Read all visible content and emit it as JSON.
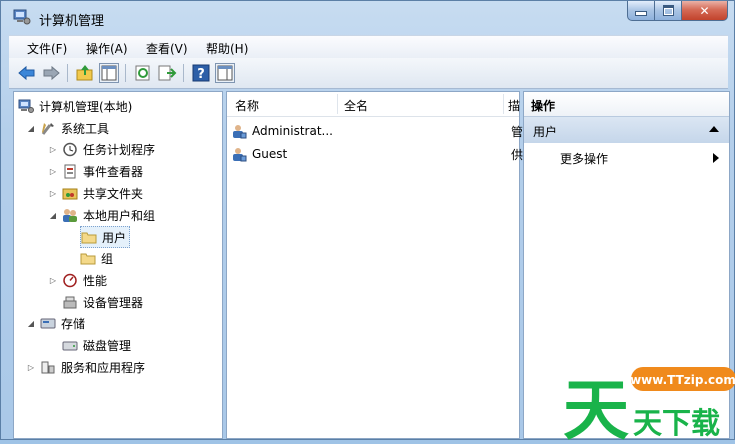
{
  "window": {
    "title": "计算机管理",
    "min_icon": "minimize-icon",
    "max_icon": "maximize-icon",
    "close_icon": "close-icon"
  },
  "menu": [
    "文件(F)",
    "操作(A)",
    "查看(V)",
    "帮助(H)"
  ],
  "toolbar": [
    "back-icon",
    "forward-icon",
    "up-folder-icon",
    "show-hide-tree-icon",
    "refresh-icon",
    "export-list-icon",
    "help-icon",
    "show-hide-action-pane-icon"
  ],
  "tree": {
    "root": "计算机管理(本地)",
    "system_tools": "系统工具",
    "task_scheduler": "任务计划程序",
    "event_viewer": "事件查看器",
    "shared_folders": "共享文件夹",
    "local_users_groups": "本地用户和组",
    "users": "用户",
    "groups": "组",
    "performance": "性能",
    "device_manager": "设备管理器",
    "storage": "存储",
    "disk_management": "磁盘管理",
    "services_apps": "服务和应用程序"
  },
  "list": {
    "columns": [
      "名称",
      "全名",
      "描"
    ],
    "rows": [
      {
        "name": "Administrat...",
        "fullname": "",
        "desc": "管"
      },
      {
        "name": "Guest",
        "fullname": "",
        "desc": "供"
      }
    ]
  },
  "actions": {
    "header": "操作",
    "section": "用户",
    "more": "更多操作"
  },
  "watermark": {
    "url": "www.TTzip.com",
    "logo_text": "天",
    "name": "天下载"
  },
  "colors": {
    "title_bg": "#b4cfeb",
    "selection": "#e5f1fb",
    "action_section": "#c5d6ea",
    "watermark_green": "#19b34a",
    "watermark_orange": "#f08a1c"
  }
}
